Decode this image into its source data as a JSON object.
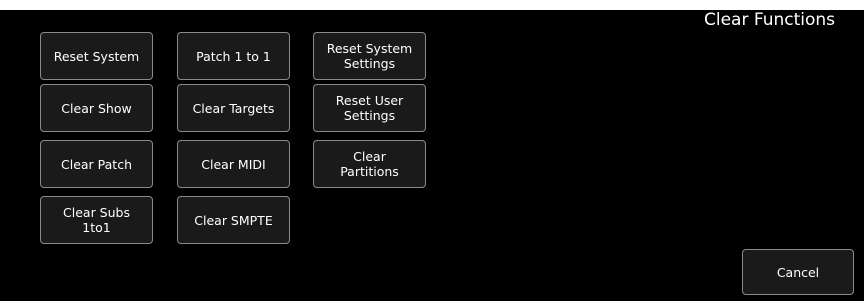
{
  "panel": {
    "title": "Clear Functions"
  },
  "buttons": {
    "reset_system": "Reset System",
    "clear_show": "Clear Show",
    "clear_patch": "Clear Patch",
    "clear_subs_1to1": "Clear Subs\n1to1",
    "patch_1_to_1": "Patch 1 to 1",
    "clear_targets": "Clear Targets",
    "clear_midi": "Clear MIDI",
    "clear_smpte": "Clear SMPTE",
    "reset_system_settings": "Reset System\nSettings",
    "reset_user_settings": "Reset User\nSettings",
    "clear_partitions": "Clear\nPartitions",
    "cancel": "Cancel"
  }
}
